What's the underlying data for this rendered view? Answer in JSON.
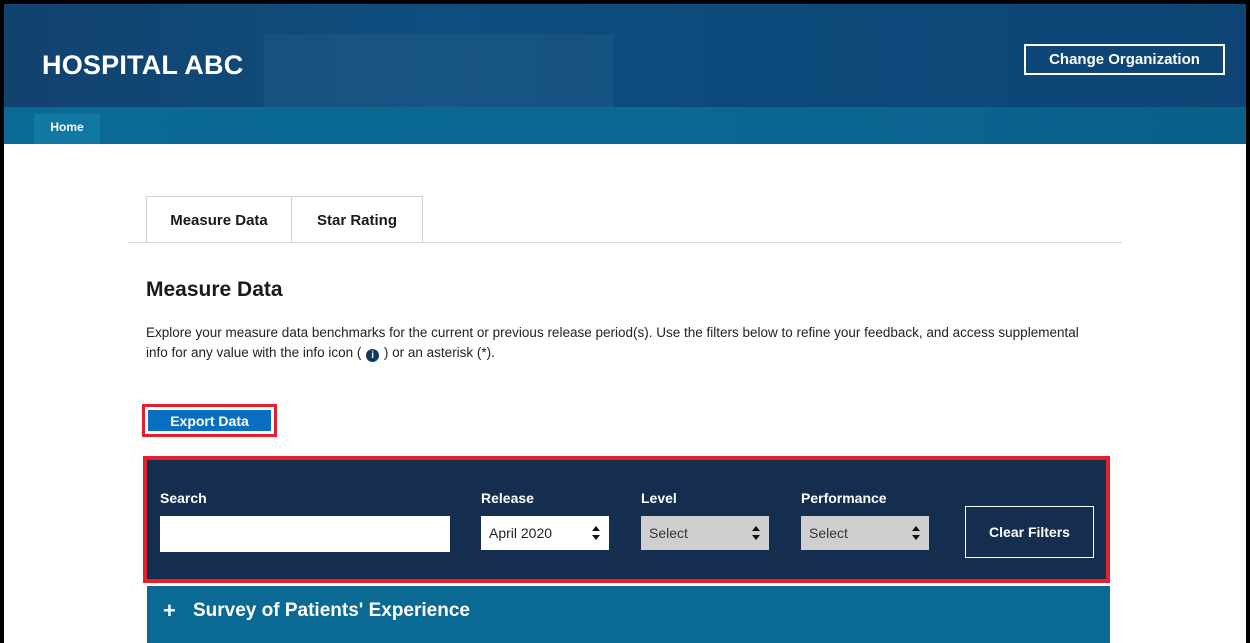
{
  "header": {
    "org_name": "HOSPITAL ABC",
    "change_org_label": "Change Organization"
  },
  "nav": {
    "items": [
      {
        "label": "Home"
      }
    ]
  },
  "tabs": [
    {
      "label": "Measure Data",
      "active": true
    },
    {
      "label": "Star Rating",
      "active": false
    }
  ],
  "section": {
    "title": "Measure Data",
    "description_part1": "Explore your measure data benchmarks for the current or previous release period(s). Use the filters below to refine your feedback, and access supplemental info for any value with the info icon (",
    "info_glyph": "i",
    "description_part2": ") or an asterisk (*)."
  },
  "export": {
    "label": "Export Data"
  },
  "filters": {
    "search_label": "Search",
    "search_value": "",
    "release_label": "Release",
    "release_value": "April 2020",
    "level_label": "Level",
    "level_value": "Select",
    "performance_label": "Performance",
    "performance_value": "Select",
    "clear_label": "Clear Filters"
  },
  "accordion": {
    "plus": "+",
    "label": "Survey of Patients' Experience"
  },
  "colors": {
    "header": "#0e4f80",
    "navbar": "#0b6a93",
    "filter_panel": "#152d4f",
    "export_button": "#0a6fc2",
    "highlight_border": "#e3202c"
  }
}
